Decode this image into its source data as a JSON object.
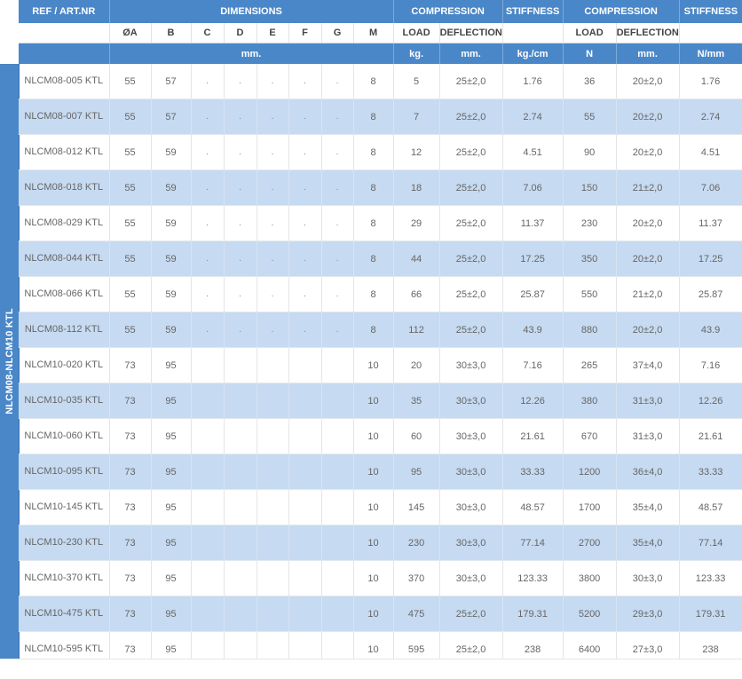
{
  "side_label": "NLCM08-NLCM10 KTL",
  "header": {
    "ref": "REF / ART.NR",
    "dimensions": "DIMENSIONS",
    "compression1": "COMPRESSION",
    "stiffness1": "STIFFNESS",
    "compression2": "COMPRESSION",
    "stiffness2": "STIFFNESS",
    "cols": [
      "ØA",
      "B",
      "C",
      "D",
      "E",
      "F",
      "G",
      "M",
      "LOAD",
      "DEFLECTION",
      "",
      "LOAD",
      "DEFLECTION",
      ""
    ],
    "units": {
      "dims": "mm.",
      "load_kg": "kg.",
      "defl1": "mm.",
      "stiff_kgcm": "kg./cm",
      "load_n": "N",
      "defl2": "mm.",
      "stiff_nmm": "N/mm"
    }
  },
  "rows": [
    {
      "ref": "NLCM08-005 KTL",
      "a": "55",
      "b": "57",
      "c": ".",
      "d": ".",
      "e": ".",
      "f": ".",
      "g": ".",
      "m": "8",
      "load_kg": "5",
      "defl1": "25±2,0",
      "stiff1": "1.76",
      "load_n": "36",
      "defl2": "20±2,0",
      "stiff2": "1.76"
    },
    {
      "ref": "NLCM08-007 KTL",
      "a": "55",
      "b": "57",
      "c": ".",
      "d": ".",
      "e": ".",
      "f": ".",
      "g": ".",
      "m": "8",
      "load_kg": "7",
      "defl1": "25±2,0",
      "stiff1": "2.74",
      "load_n": "55",
      "defl2": "20±2,0",
      "stiff2": "2.74"
    },
    {
      "ref": "NLCM08-012 KTL",
      "a": "55",
      "b": "59",
      "c": ".",
      "d": ".",
      "e": ".",
      "f": ".",
      "g": ".",
      "m": "8",
      "load_kg": "12",
      "defl1": "25±2,0",
      "stiff1": "4.51",
      "load_n": "90",
      "defl2": "20±2,0",
      "stiff2": "4.51"
    },
    {
      "ref": "NLCM08-018 KTL",
      "a": "55",
      "b": "59",
      "c": ".",
      "d": ".",
      "e": ".",
      "f": ".",
      "g": ".",
      "m": "8",
      "load_kg": "18",
      "defl1": "25±2,0",
      "stiff1": "7.06",
      "load_n": "150",
      "defl2": "21±2,0",
      "stiff2": "7.06"
    },
    {
      "ref": "NLCM08-029 KTL",
      "a": "55",
      "b": "59",
      "c": ".",
      "d": ".",
      "e": ".",
      "f": ".",
      "g": ".",
      "m": "8",
      "load_kg": "29",
      "defl1": "25±2,0",
      "stiff1": "11.37",
      "load_n": "230",
      "defl2": "20±2,0",
      "stiff2": "11.37"
    },
    {
      "ref": "NLCM08-044 KTL",
      "a": "55",
      "b": "59",
      "c": ".",
      "d": ".",
      "e": ".",
      "f": ".",
      "g": ".",
      "m": "8",
      "load_kg": "44",
      "defl1": "25±2,0",
      "stiff1": "17.25",
      "load_n": "350",
      "defl2": "20±2,0",
      "stiff2": "17.25"
    },
    {
      "ref": "NLCM08-066 KTL",
      "a": "55",
      "b": "59",
      "c": ".",
      "d": ".",
      "e": ".",
      "f": ".",
      "g": ".",
      "m": "8",
      "load_kg": "66",
      "defl1": "25±2,0",
      "stiff1": "25.87",
      "load_n": "550",
      "defl2": "21±2,0",
      "stiff2": "25.87"
    },
    {
      "ref": "NLCM08-112 KTL",
      "a": "55",
      "b": "59",
      "c": ".",
      "d": ".",
      "e": ".",
      "f": ".",
      "g": ".",
      "m": "8",
      "load_kg": "112",
      "defl1": "25±2,0",
      "stiff1": "43.9",
      "load_n": "880",
      "defl2": "20±2,0",
      "stiff2": "43.9"
    },
    {
      "ref": "NLCM10-020 KTL",
      "a": "73",
      "b": "95",
      "c": "",
      "d": "",
      "e": "",
      "f": "",
      "g": "",
      "m": "10",
      "load_kg": "20",
      "defl1": "30±3,0",
      "stiff1": "7.16",
      "load_n": "265",
      "defl2": "37±4,0",
      "stiff2": "7.16"
    },
    {
      "ref": "NLCM10-035 KTL",
      "a": "73",
      "b": "95",
      "c": "",
      "d": "",
      "e": "",
      "f": "",
      "g": "",
      "m": "10",
      "load_kg": "35",
      "defl1": "30±3,0",
      "stiff1": "12.26",
      "load_n": "380",
      "defl2": "31±3,0",
      "stiff2": "12.26"
    },
    {
      "ref": "NLCM10-060 KTL",
      "a": "73",
      "b": "95",
      "c": "",
      "d": "",
      "e": "",
      "f": "",
      "g": "",
      "m": "10",
      "load_kg": "60",
      "defl1": "30±3,0",
      "stiff1": "21.61",
      "load_n": "670",
      "defl2": "31±3,0",
      "stiff2": "21.61"
    },
    {
      "ref": "NLCM10-095 KTL",
      "a": "73",
      "b": "95",
      "c": "",
      "d": "",
      "e": "",
      "f": "",
      "g": "",
      "m": "10",
      "load_kg": "95",
      "defl1": "30±3,0",
      "stiff1": "33.33",
      "load_n": "1200",
      "defl2": "36±4,0",
      "stiff2": "33.33"
    },
    {
      "ref": "NLCM10-145 KTL",
      "a": "73",
      "b": "95",
      "c": "",
      "d": "",
      "e": "",
      "f": "",
      "g": "",
      "m": "10",
      "load_kg": "145",
      "defl1": "30±3,0",
      "stiff1": "48.57",
      "load_n": "1700",
      "defl2": "35±4,0",
      "stiff2": "48.57"
    },
    {
      "ref": "NLCM10-230 KTL",
      "a": "73",
      "b": "95",
      "c": "",
      "d": "",
      "e": "",
      "f": "",
      "g": "",
      "m": "10",
      "load_kg": "230",
      "defl1": "30±3,0",
      "stiff1": "77.14",
      "load_n": "2700",
      "defl2": "35±4,0",
      "stiff2": "77.14"
    },
    {
      "ref": "NLCM10-370 KTL",
      "a": "73",
      "b": "95",
      "c": "",
      "d": "",
      "e": "",
      "f": "",
      "g": "",
      "m": "10",
      "load_kg": "370",
      "defl1": "30±3,0",
      "stiff1": "123.33",
      "load_n": "3800",
      "defl2": "30±3,0",
      "stiff2": "123.33"
    },
    {
      "ref": "NLCM10-475 KTL",
      "a": "73",
      "b": "95",
      "c": "",
      "d": "",
      "e": "",
      "f": "",
      "g": "",
      "m": "10",
      "load_kg": "475",
      "defl1": "25±2,0",
      "stiff1": "179.31",
      "load_n": "5200",
      "defl2": "29±3,0",
      "stiff2": "179.31"
    },
    {
      "ref": "NLCM10-595 KTL",
      "a": "73",
      "b": "95",
      "c": "",
      "d": "",
      "e": "",
      "f": "",
      "g": "",
      "m": "10",
      "load_kg": "595",
      "defl1": "25±2,0",
      "stiff1": "238",
      "load_n": "6400",
      "defl2": "27±3,0",
      "stiff2": "238"
    }
  ]
}
